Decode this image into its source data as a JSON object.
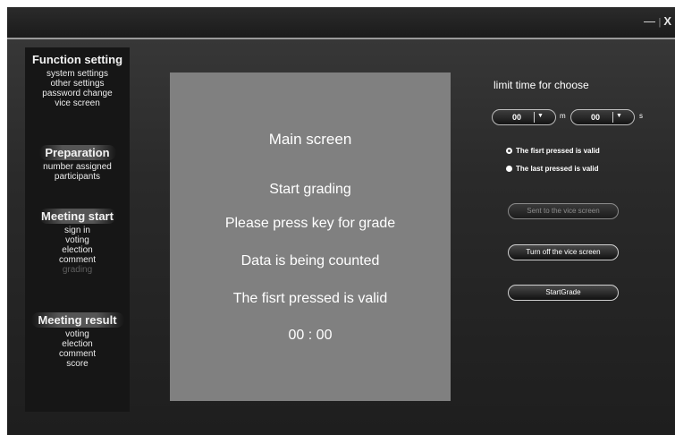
{
  "window": {
    "minimize_glyph": "—",
    "separator_glyph": "|",
    "close_glyph": "X"
  },
  "sidebar": {
    "sections": [
      {
        "title": "Function setting",
        "items": [
          {
            "label": "system settings",
            "disabled": false
          },
          {
            "label": "other settings",
            "disabled": false
          },
          {
            "label": "password change",
            "disabled": false
          },
          {
            "label": "vice screen",
            "disabled": false
          }
        ]
      },
      {
        "title": "Preparation",
        "items": [
          {
            "label": "number assigned",
            "disabled": false
          },
          {
            "label": "participants",
            "disabled": false
          }
        ]
      },
      {
        "title": "Meeting start",
        "items": [
          {
            "label": "sign in",
            "disabled": false
          },
          {
            "label": "voting",
            "disabled": false
          },
          {
            "label": "election",
            "disabled": false
          },
          {
            "label": "comment",
            "disabled": false
          },
          {
            "label": "grading",
            "disabled": true
          }
        ]
      },
      {
        "title": "Meeting result",
        "items": [
          {
            "label": "voting",
            "disabled": false
          },
          {
            "label": "election",
            "disabled": false
          },
          {
            "label": "comment",
            "disabled": false
          },
          {
            "label": "score",
            "disabled": false
          }
        ]
      }
    ]
  },
  "main": {
    "title": "Main screen",
    "lines": [
      "Start grading",
      "Please press key for grade",
      "Data is being counted",
      "The fisrt pressed is valid",
      "00 : 00"
    ]
  },
  "right": {
    "limit_label": "limit time for choose",
    "minutes_value": "00",
    "minutes_unit": "m",
    "seconds_value": "00",
    "seconds_unit": "s",
    "dropdown_glyph": "▼",
    "radios": [
      {
        "label": "The fisrt pressed is valid",
        "selected": true
      },
      {
        "label": "The last pressed is valid",
        "selected": false
      }
    ],
    "buttons": [
      {
        "label": "Sent to the vice screen",
        "disabled": true
      },
      {
        "label": "Turn off the vice screen",
        "disabled": false
      },
      {
        "label": "StartGrade",
        "disabled": false
      }
    ]
  },
  "colors": {
    "background": "#2a2a2a",
    "panel": "#808080",
    "sidebar": "#161616",
    "text": "#ffffff",
    "disabled_text": "#5e5e5e"
  }
}
